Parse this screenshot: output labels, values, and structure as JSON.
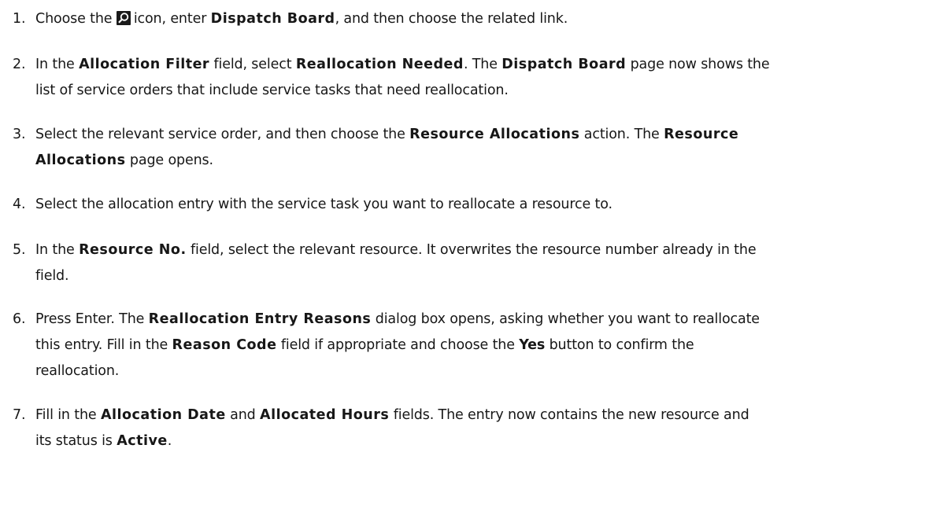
{
  "steps": [
    {
      "number": "1.",
      "parts": [
        "Choose the ",
        "icon, enter ",
        "Dispatch Board",
        ", and then choose the related link."
      ]
    },
    {
      "number": "2.",
      "parts": [
        "In the ",
        "Allocation Filter",
        " field, select ",
        "Reallocation Needed",
        ". The ",
        "Dispatch Board",
        " page now shows the",
        "list of service orders that include service tasks that need reallocation."
      ]
    },
    {
      "number": "3.",
      "parts": [
        "Select the relevant service order, and then choose the ",
        "Resource Allocations",
        " action. The ",
        "Resource",
        "Allocations",
        " page opens."
      ]
    },
    {
      "number": "4.",
      "parts": [
        "Select the allocation entry with the service task you want to reallocate a resource to."
      ]
    },
    {
      "number": "5.",
      "parts": [
        "In the ",
        "Resource No.",
        " field, select the relevant resource. It overwrites the resource number already in the",
        "field."
      ]
    },
    {
      "number": "6.",
      "parts": [
        "Press Enter. The ",
        "Reallocation Entry Reasons",
        " dialog box opens, asking whether you want to reallocate",
        "this entry. Fill in the ",
        "Reason Code",
        " field if appropriate and choose the ",
        "Yes",
        " button to confirm the",
        "reallocation."
      ]
    },
    {
      "number": "7.",
      "parts": [
        "Fill in the ",
        "Allocation Date",
        " and ",
        "Allocated Hours",
        " fields. The entry now contains the new resource and",
        "its status is ",
        "Active",
        "."
      ]
    }
  ],
  "icons": {
    "search": "search-icon"
  }
}
